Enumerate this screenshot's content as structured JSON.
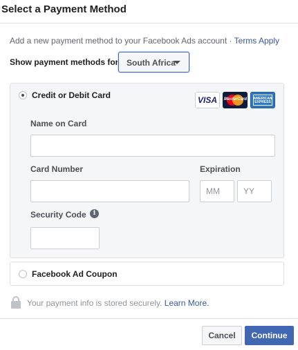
{
  "dialog": {
    "title": "Select a Payment Method"
  },
  "intro": {
    "text": "Add a new payment method to your Facebook Ads account · ",
    "terms_link": "Terms Apply"
  },
  "country": {
    "label": "Show payment methods for:",
    "selected": "South Africa"
  },
  "card_option": {
    "label": "Credit or Debit Card",
    "selected": true,
    "logos": [
      {
        "name": "visa-logo",
        "text": "VISA"
      },
      {
        "name": "mastercard-logo",
        "text": "MasterCard"
      },
      {
        "name": "amex-logo",
        "text": "AMERICAN EXPRESS"
      }
    ],
    "name_label": "Name on Card",
    "name_value": "",
    "number_label": "Card Number",
    "number_value": "",
    "expiration_label": "Expiration",
    "month_placeholder": "MM",
    "year_placeholder": "YY",
    "security_label": "Security Code",
    "security_value": "",
    "info_icon": "info-icon"
  },
  "coupon_option": {
    "label": "Facebook Ad Coupon",
    "selected": false
  },
  "secure": {
    "text": "Your payment info is stored securely. ",
    "link": "Learn More."
  },
  "footer": {
    "cancel_label": "Cancel",
    "continue_label": "Continue"
  },
  "colors": {
    "accent": "#4267b2",
    "link": "#385898",
    "panel_bg": "#f5f6f7",
    "border": "#dddfe2"
  }
}
